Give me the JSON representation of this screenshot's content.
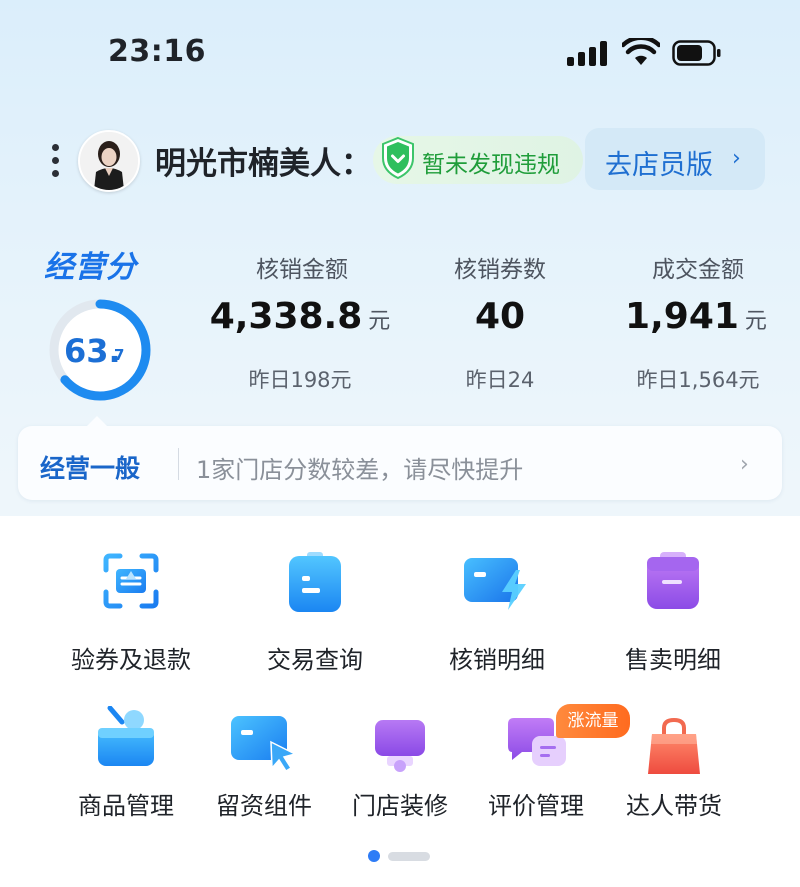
{
  "status_bar": {
    "time": "23:16"
  },
  "header": {
    "shop_name": "明光市楠美人：",
    "safety_status": "暂未发现违规",
    "staff_version_button": "去店员版",
    "staff_chevron": "›"
  },
  "score": {
    "label": "经营分",
    "value_int": "63.",
    "value_dec": "7",
    "value": 63.7
  },
  "metrics": [
    {
      "label": "核销金额",
      "value": "4,338.8",
      "unit": "元",
      "yesterday": "昨日198元"
    },
    {
      "label": "核销券数",
      "value": "40",
      "unit": "",
      "yesterday": "昨日24"
    },
    {
      "label": "成交金额",
      "value": "1,941",
      "unit": "元",
      "yesterday": "昨日1,564元"
    }
  ],
  "notice": {
    "status": "经营一般",
    "message": "1家门店分数较差，请尽快提升",
    "chevron": "›"
  },
  "tools": [
    {
      "label": "验券及退款",
      "icon": "scan-coupon-icon"
    },
    {
      "label": "交易查询",
      "icon": "transaction-doc-icon"
    },
    {
      "label": "核销明细",
      "icon": "verification-card-icon"
    },
    {
      "label": "售卖明细",
      "icon": "sales-clipboard-icon"
    },
    {
      "label": "商品管理",
      "icon": "product-basket-icon"
    },
    {
      "label": "留资组件",
      "icon": "lead-card-icon"
    },
    {
      "label": "门店装修",
      "icon": "store-decor-icon"
    },
    {
      "label": "评价管理",
      "icon": "review-chat-icon",
      "badge": "涨流量"
    },
    {
      "label": "达人带货",
      "icon": "shopping-bag-icon"
    }
  ],
  "pager": {
    "pages": 2,
    "current": 1
  },
  "colors": {
    "brand_blue": "#1a73e8",
    "safe_green": "#1f9d3a",
    "badge_orange": "#ff6b1f"
  }
}
